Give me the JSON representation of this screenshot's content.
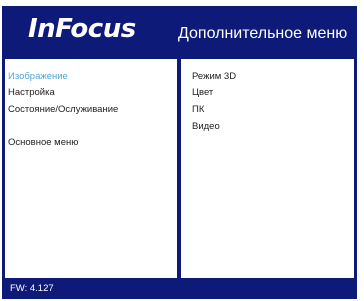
{
  "header": {
    "logo": "InFocus",
    "title": "Дополнительное меню"
  },
  "left_menu": {
    "items": [
      {
        "label": "Изображение",
        "selected": true
      },
      {
        "label": "Настройка",
        "selected": false
      },
      {
        "label": "Состояние/Ослуживание",
        "selected": false
      },
      {
        "label": "Основное меню",
        "selected": false
      }
    ]
  },
  "right_menu": {
    "items": [
      {
        "label": "Режим 3D"
      },
      {
        "label": "Цвет"
      },
      {
        "label": "ПК"
      },
      {
        "label": "Видео"
      }
    ]
  },
  "footer": {
    "firmware": "FW: 4.127"
  },
  "colors": {
    "frame": "#0e1a78",
    "selected_text": "#55a4d8",
    "text": "#222222",
    "panel": "#ffffff"
  }
}
